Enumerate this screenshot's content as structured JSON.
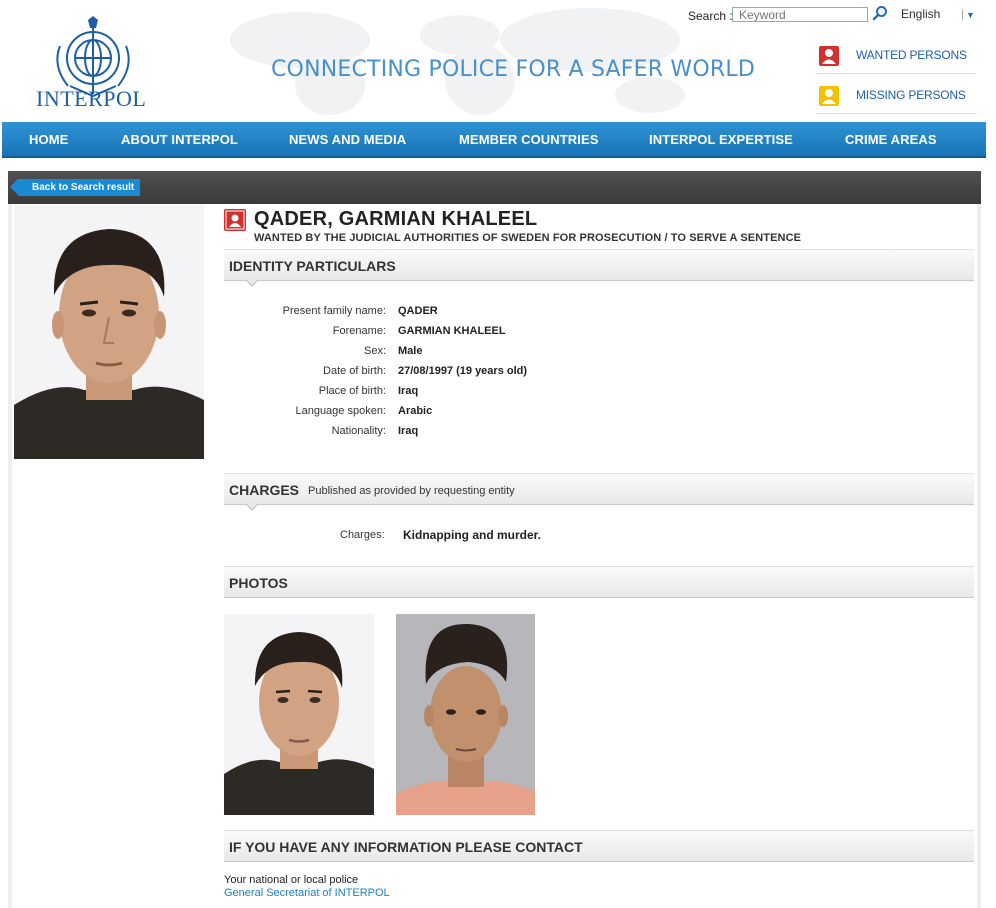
{
  "header": {
    "logo_text": "INTERPOL",
    "tagline": "CONNECTING POLICE FOR A SAFER WORLD",
    "search_label": "Search :",
    "search_placeholder": "Keyword",
    "language": "English",
    "quick_links": [
      {
        "label": "WANTED PERSONS",
        "icon": "wanted-notice-icon",
        "color": "#d32f2f"
      },
      {
        "label": "MISSING PERSONS",
        "icon": "missing-notice-icon",
        "color": "#f2c200"
      }
    ]
  },
  "nav": {
    "items": [
      "HOME",
      "ABOUT INTERPOL",
      "NEWS AND MEDIA",
      "MEMBER COUNTRIES",
      "INTERPOL EXPERTISE",
      "CRIME AREAS"
    ]
  },
  "back_button": "Back to Search result",
  "person": {
    "name": "QADER, GARMIAN KHALEEL",
    "subtitle": "WANTED BY THE JUDICIAL AUTHORITIES OF SWEDEN FOR PROSECUTION / TO SERVE A SENTENCE"
  },
  "identity": {
    "title": "IDENTITY PARTICULARS",
    "fields": [
      {
        "label": "Present family name:",
        "value": "QADER"
      },
      {
        "label": "Forename:",
        "value": "GARMIAN KHALEEL"
      },
      {
        "label": "Sex:",
        "value": "Male"
      },
      {
        "label": "Date of birth:",
        "value": "27/08/1997 (19 years old)"
      },
      {
        "label": "Place of birth:",
        "value": "Iraq"
      },
      {
        "label": "Language spoken:",
        "value": "Arabic"
      },
      {
        "label": "Nationality:",
        "value": "Iraq"
      }
    ]
  },
  "charges": {
    "title": "CHARGES",
    "subtitle": "Published as provided by requesting entity",
    "label": "Charges:",
    "value": "Kidnapping and murder."
  },
  "photos": {
    "title": "PHOTOS"
  },
  "contact": {
    "title": "IF YOU HAVE ANY INFORMATION PLEASE CONTACT",
    "line1": "Your national or local police",
    "link": "General Secretariat of INTERPOL"
  },
  "colors": {
    "nav_blue": "#1e80c4",
    "brand_blue": "#1d5fa7",
    "link_blue": "#1d7fc4",
    "back_button": "#1a8ad4"
  }
}
